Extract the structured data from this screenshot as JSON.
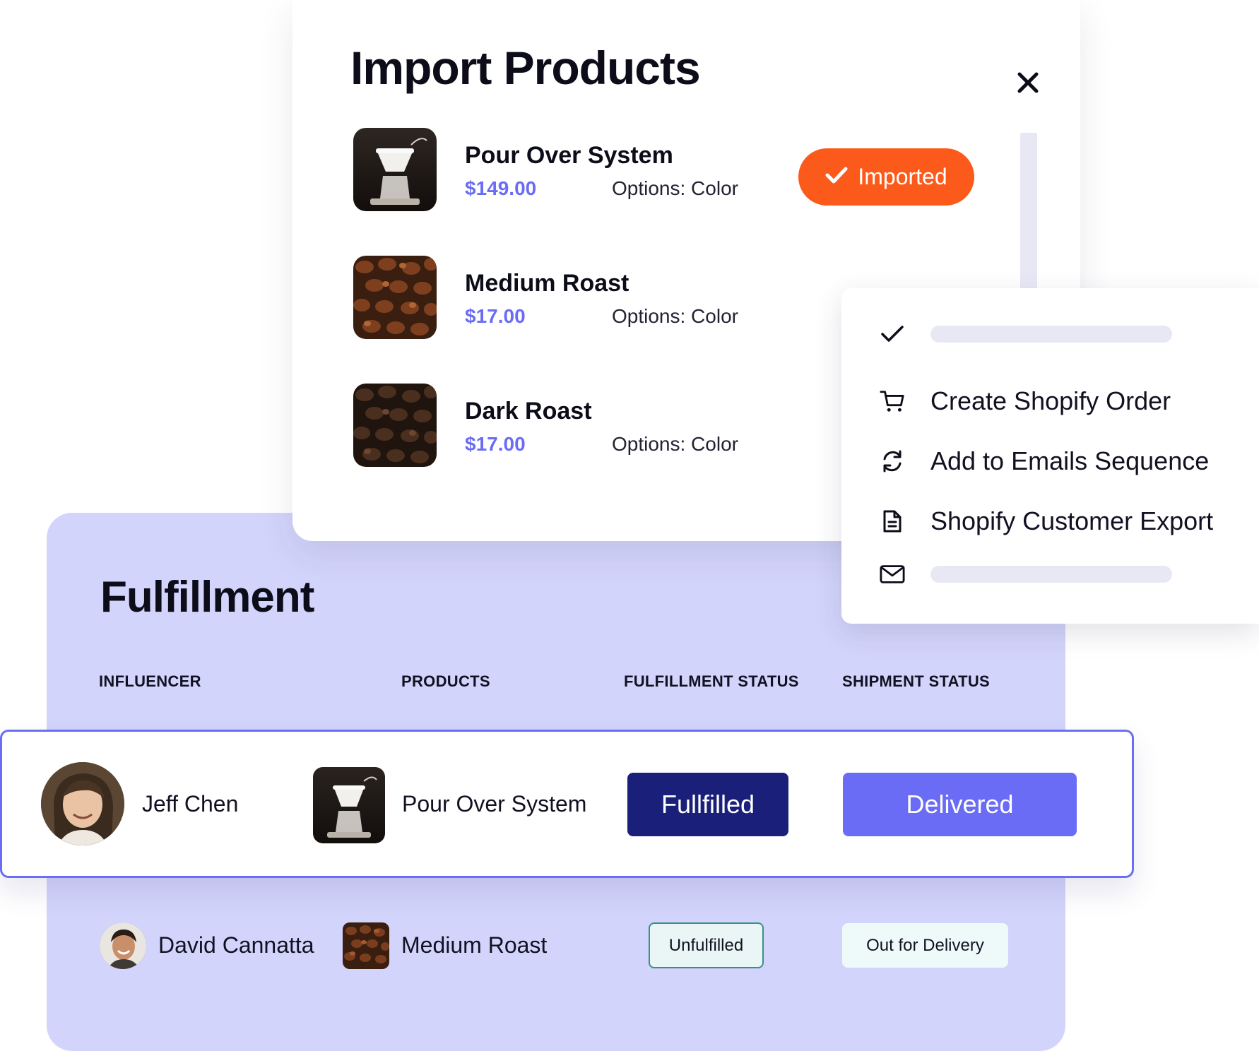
{
  "import_panel": {
    "title": "Import Products",
    "products": [
      {
        "name": "Pour Over System",
        "price": "$149.00",
        "options": "Options: Color",
        "status": "Imported"
      },
      {
        "name": "Medium Roast",
        "price": "$17.00",
        "options": "Options: Color"
      },
      {
        "name": "Dark Roast",
        "price": "$17.00",
        "options": "Options: Color"
      }
    ],
    "imported_label": "Imported"
  },
  "menu": {
    "items": [
      {
        "label": "Create Shopify Order",
        "icon": "cart-icon"
      },
      {
        "label": "Add to Emails Sequence",
        "icon": "refresh-icon"
      },
      {
        "label": "Shopify Customer Export",
        "icon": "document-icon"
      }
    ]
  },
  "fulfillment": {
    "title": "Fulfillment",
    "columns": [
      "INFLUENCER",
      "PRODUCTS",
      "FULFILLMENT STATUS",
      "SHIPMENT STATUS"
    ],
    "rows": [
      {
        "influencer": "Jeff Chen",
        "product": "Pour Over System",
        "fulfillment_status": "Fullfilled",
        "shipment_status": "Delivered"
      },
      {
        "influencer": "David Cannatta",
        "product": "Medium Roast",
        "fulfillment_status": "Unfulfilled",
        "shipment_status": "Out for Delivery"
      }
    ]
  },
  "colors": {
    "accent": "#6a6cf6",
    "imported": "#fc5a1a",
    "fulfilled": "#1a207a",
    "panel": "#d3d4fb"
  }
}
